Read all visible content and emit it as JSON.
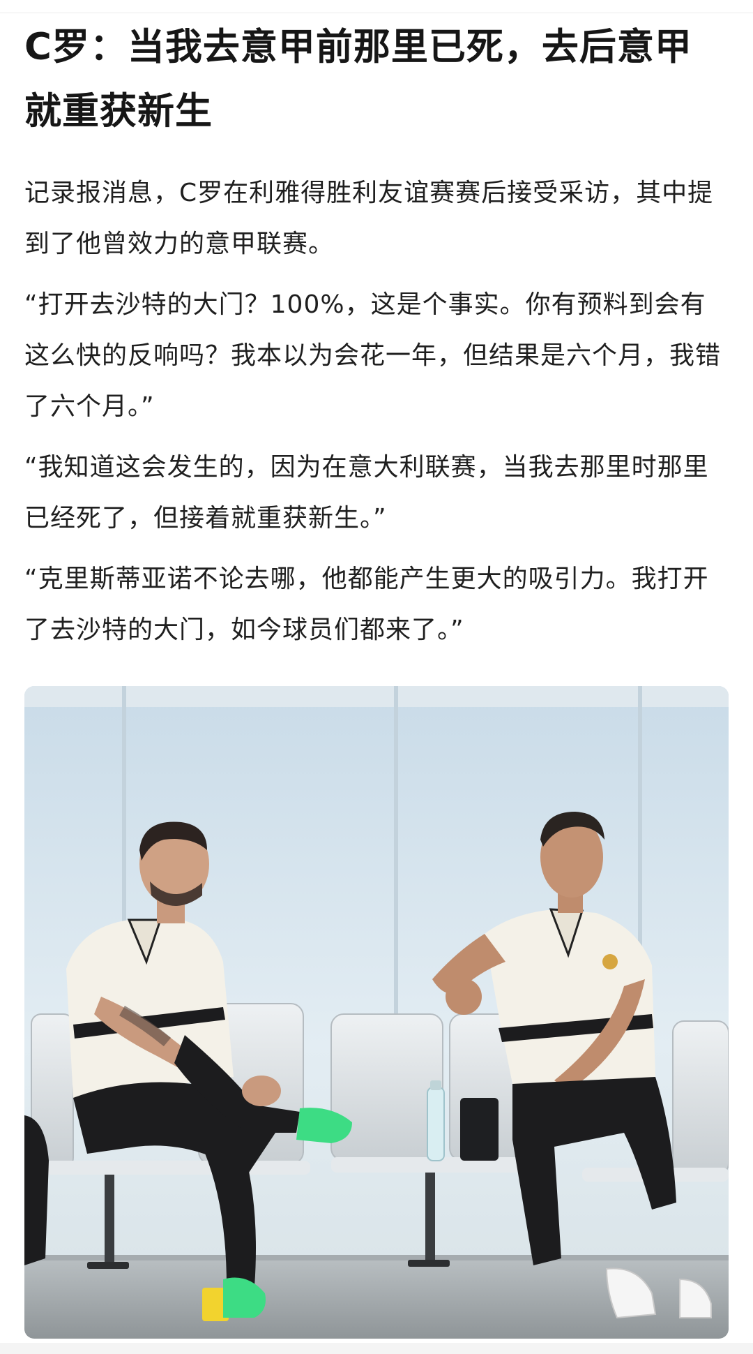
{
  "article": {
    "title": "C罗：当我去意甲前那里已死，去后意甲就重获新生",
    "paragraphs": [
      "记录报消息，C罗在利雅得胜利友谊赛赛后接受采访，其中提到了他曾效力的意甲联赛。",
      "“打开去沙特的大门？100%，这是个事实。你有预料到会有这么快的反响吗？我本以为会花一年，但结果是六个月，我错了六个月。”",
      "“我知道这会发生的，因为在意大利联赛，当我去那里时那里已经死了，但接着就重获新生。”",
      "“克里斯蒂亚诺不论去哪，他都能产生更大的吸引力。我打开了去沙特的大门，如今球员们都来了。”"
    ]
  },
  "colors": {
    "title": "#161616",
    "body_text": "#1f1f1f",
    "background": "#ffffff",
    "shoe_green": "#3ddc84",
    "shirt_white": "#f4f1e8",
    "pants_black": "#1c1c1e"
  },
  "photo": {
    "icon": "article-photo"
  }
}
